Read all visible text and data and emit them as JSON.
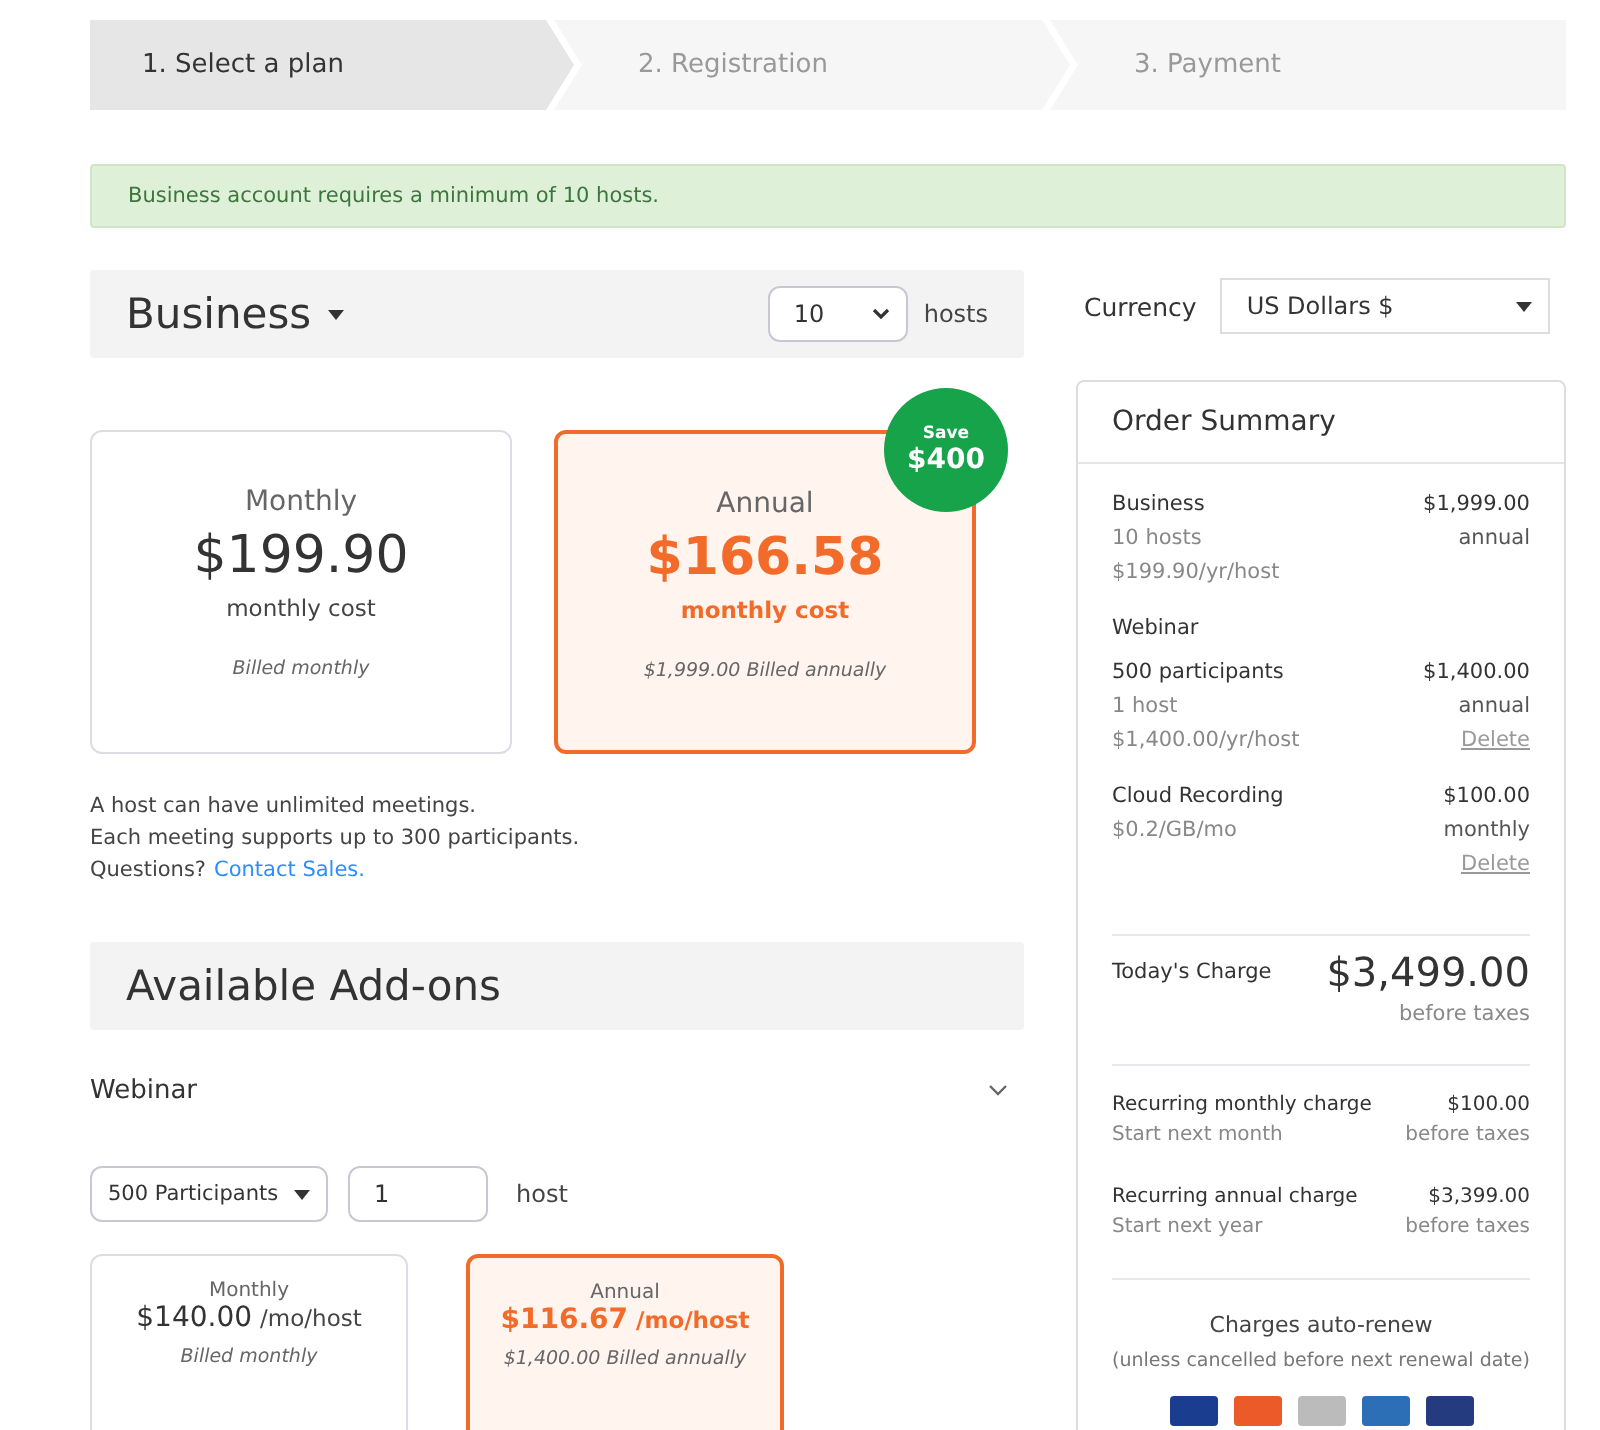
{
  "steps": [
    {
      "label": "1. Select a plan",
      "selected": true
    },
    {
      "label": "2. Registration",
      "selected": false
    },
    {
      "label": "3. Payment",
      "selected": false
    }
  ],
  "alert": "Business account requires a minimum of 10 hosts.",
  "plan": {
    "name": "Business",
    "hosts_value": "10",
    "hosts_label": "hosts"
  },
  "plan_options": [
    {
      "period": "Monthly",
      "price": "$199.90",
      "unit": "monthly cost",
      "billing": "Billed monthly",
      "selected": false
    },
    {
      "period": "Annual",
      "price": "$166.58",
      "unit": "monthly cost",
      "billing": "$1,999.00 Billed annually",
      "selected": true,
      "badge_top": "Save",
      "badge_amount": "$400"
    }
  ],
  "plan_notes": [
    "A host can have unlimited meetings.",
    "Each meeting supports up to 300 participants."
  ],
  "questions": {
    "text": "Questions?",
    "link": "Contact Sales."
  },
  "addons_title": "Available Add-ons",
  "addon": {
    "name": "Webinar",
    "expanded": true,
    "participants": "500 Participants",
    "hosts_value": "1",
    "hosts_label": "host"
  },
  "addon_options": [
    {
      "period": "Monthly",
      "price": "$140.00",
      "unit": "/mo/host",
      "billing": "Billed monthly",
      "selected": false
    },
    {
      "period": "Annual",
      "price": "$116.67",
      "unit": "/mo/host",
      "billing": "$1,400.00 Billed annually",
      "selected": true
    }
  ],
  "currency": {
    "label": "Currency",
    "value": "US Dollars $"
  },
  "summary": {
    "title": "Order Summary",
    "items": [
      {
        "title": "Business",
        "amount": "$1,999.00",
        "lines": [
          {
            "left": "10 hosts",
            "right": "annual"
          },
          {
            "left": "$199.90/yr/host"
          }
        ]
      },
      {
        "group": "Webinar",
        "title": "500 participants",
        "amount": "$1,400.00",
        "lines": [
          {
            "left": "1 host",
            "right": "annual"
          },
          {
            "left": "$1,400.00/yr/host",
            "action": "Delete"
          }
        ]
      },
      {
        "title": "Cloud Recording",
        "amount": "$100.00",
        "lines": [
          {
            "left": "$0.2/GB/mo",
            "right": "monthly"
          },
          {
            "action": "Delete"
          }
        ]
      }
    ],
    "today_label": "Today's Charge",
    "today_amount": "$3,499.00",
    "today_note": "before taxes",
    "recurring": [
      {
        "label": "Recurring monthly charge",
        "sub": "Start next month",
        "amount": "$100.00",
        "note": "before taxes"
      },
      {
        "label": "Recurring annual charge",
        "sub": "Start next year",
        "amount": "$3,399.00",
        "note": "before taxes"
      }
    ],
    "renew_title": "Charges auto-renew",
    "renew_note": "(unless cancelled before next renewal date)",
    "cards": [
      {
        "kind": "visa"
      },
      {
        "kind": "mastercard"
      },
      {
        "kind": "discover"
      },
      {
        "kind": "amex"
      },
      {
        "kind": "paypal"
      }
    ]
  }
}
